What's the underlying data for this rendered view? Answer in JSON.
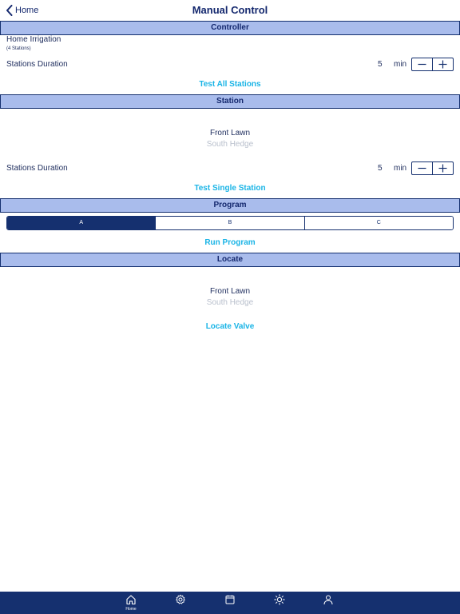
{
  "header": {
    "back_label": "Home",
    "title": "Manual Control"
  },
  "controller": {
    "section_title": "Controller",
    "name": "Home Irrigation",
    "stations_count": "(4 Stations)",
    "duration_label": "Stations Duration",
    "duration_value": "5",
    "duration_unit": "min",
    "action_label": "Test All Stations"
  },
  "station": {
    "section_title": "Station",
    "picker_selected": "Front Lawn",
    "picker_next": "South Hedge",
    "duration_label": "Stations Duration",
    "duration_value": "5",
    "duration_unit": "min",
    "action_label": "Test Single Station"
  },
  "program": {
    "section_title": "Program",
    "options": [
      "A",
      "B",
      "C"
    ],
    "selected": "A",
    "action_label": "Run Program"
  },
  "locate": {
    "section_title": "Locate",
    "picker_selected": "Front Lawn",
    "picker_next": "South Hedge",
    "action_label": "Locate Valve"
  },
  "tabbar": {
    "items": [
      {
        "icon": "home-icon",
        "label": "Home",
        "active": true
      },
      {
        "icon": "gear-icon",
        "label": ""
      },
      {
        "icon": "calendar-icon",
        "label": ""
      },
      {
        "icon": "sun-icon",
        "label": ""
      },
      {
        "icon": "user-icon",
        "label": ""
      }
    ]
  },
  "colors": {
    "primary": "#15306f",
    "section_bg": "#a9bcec",
    "accent": "#19b4e6",
    "muted": "#b8bfcc"
  }
}
